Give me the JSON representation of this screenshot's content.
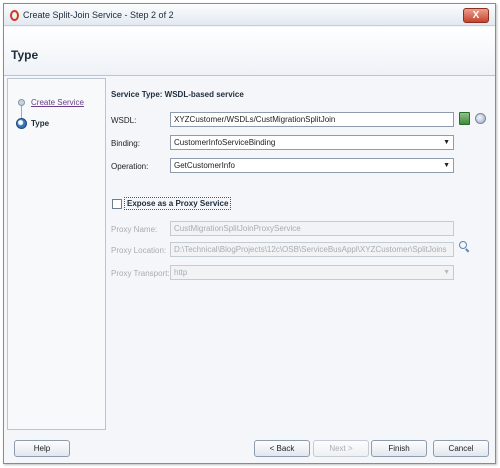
{
  "window": {
    "title": "Create Split-Join Service - Step 2 of 2",
    "close_label": "X"
  },
  "header": {
    "title": "Type"
  },
  "steps": [
    {
      "label": "Create Service",
      "state": "done"
    },
    {
      "label": "Type",
      "state": "current"
    }
  ],
  "service_type": "Service Type: WSDL-based service",
  "form": {
    "wsdl_label": "WSDL:",
    "wsdl_value": "XYZCustomer/WSDLs/CustMigrationSplitJoin",
    "binding_label": "Binding:",
    "binding_value": "CustomerInfoServiceBinding",
    "operation_label": "Operation:",
    "operation_value": "GetCustomerInfo"
  },
  "proxy": {
    "expose_label": "Expose as a Proxy Service",
    "expose_checked": false,
    "name_label": "Proxy Name:",
    "name_value": "CustMigrationSplitJoinProxyService",
    "location_label": "Proxy Location:",
    "location_value": "D:\\Technical\\BlogProjects\\12c\\OSB\\ServiceBusAppl\\XYZCustomer\\SplitJoins",
    "transport_label": "Proxy Transport:",
    "transport_value": "http"
  },
  "buttons": {
    "help": "Help",
    "back": "< Back",
    "next": "Next >",
    "finish": "Finish",
    "cancel": "Cancel"
  },
  "colors": {
    "close_button": "#c7432c",
    "link": "#6a3d8a",
    "current_step": "#3f7dc4",
    "disabled_text": "#a8adb3"
  }
}
